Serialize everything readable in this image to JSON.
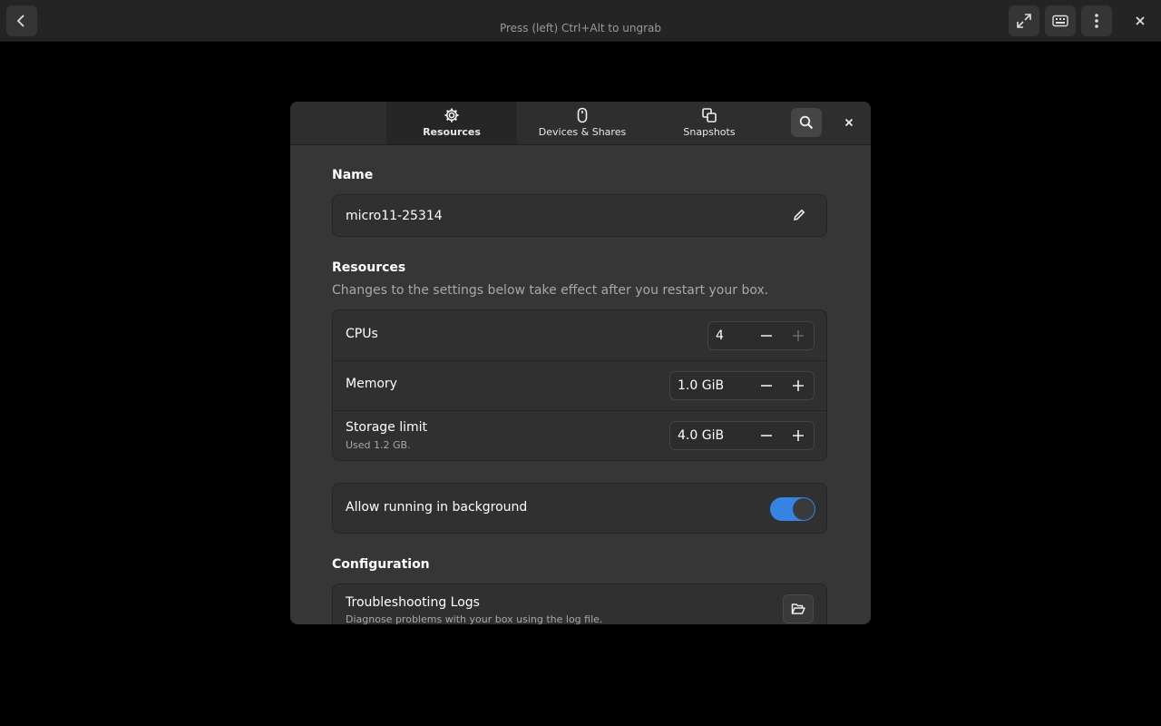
{
  "topbar": {
    "hint": "Press (left) Ctrl+Alt to ungrab",
    "buttons": {
      "back_icon": "chevron-left-icon",
      "fullscreen_icon": "expand-arrows-icon",
      "keyboard_icon": "keyboard-icon",
      "menu_icon": "vertical-dots-icon",
      "close_icon": "close-icon"
    }
  },
  "dialog": {
    "tabs": [
      {
        "label": "Resources",
        "icon": "gear-icon",
        "active": true
      },
      {
        "label": "Devices & Shares",
        "icon": "mouse-icon",
        "active": false
      },
      {
        "label": "Snapshots",
        "icon": "snapshots-icon",
        "active": false
      }
    ],
    "name_section": {
      "heading": "Name",
      "value": "micro11-25314",
      "edit_icon": "pencil-icon"
    },
    "resources_section": {
      "heading": "Resources",
      "description": "Changes to the settings below take effect after you restart your box.",
      "rows": [
        {
          "title": "CPUs",
          "value": "4"
        },
        {
          "title": "Memory",
          "value": "1.0 GiB"
        },
        {
          "title": "Storage limit",
          "subtitle": "Used 1.2 GB.",
          "value": "4.0 GiB"
        }
      ]
    },
    "background": {
      "label": "Allow running in background",
      "enabled": true
    },
    "configuration_section": {
      "heading": "Configuration",
      "logs_title": "Troubleshooting Logs",
      "logs_subtitle": "Diagnose problems with your box using the log file."
    }
  },
  "colors": {
    "accent": "#3584e4",
    "dialog_bg": "#363636",
    "card_bg": "#303030"
  }
}
